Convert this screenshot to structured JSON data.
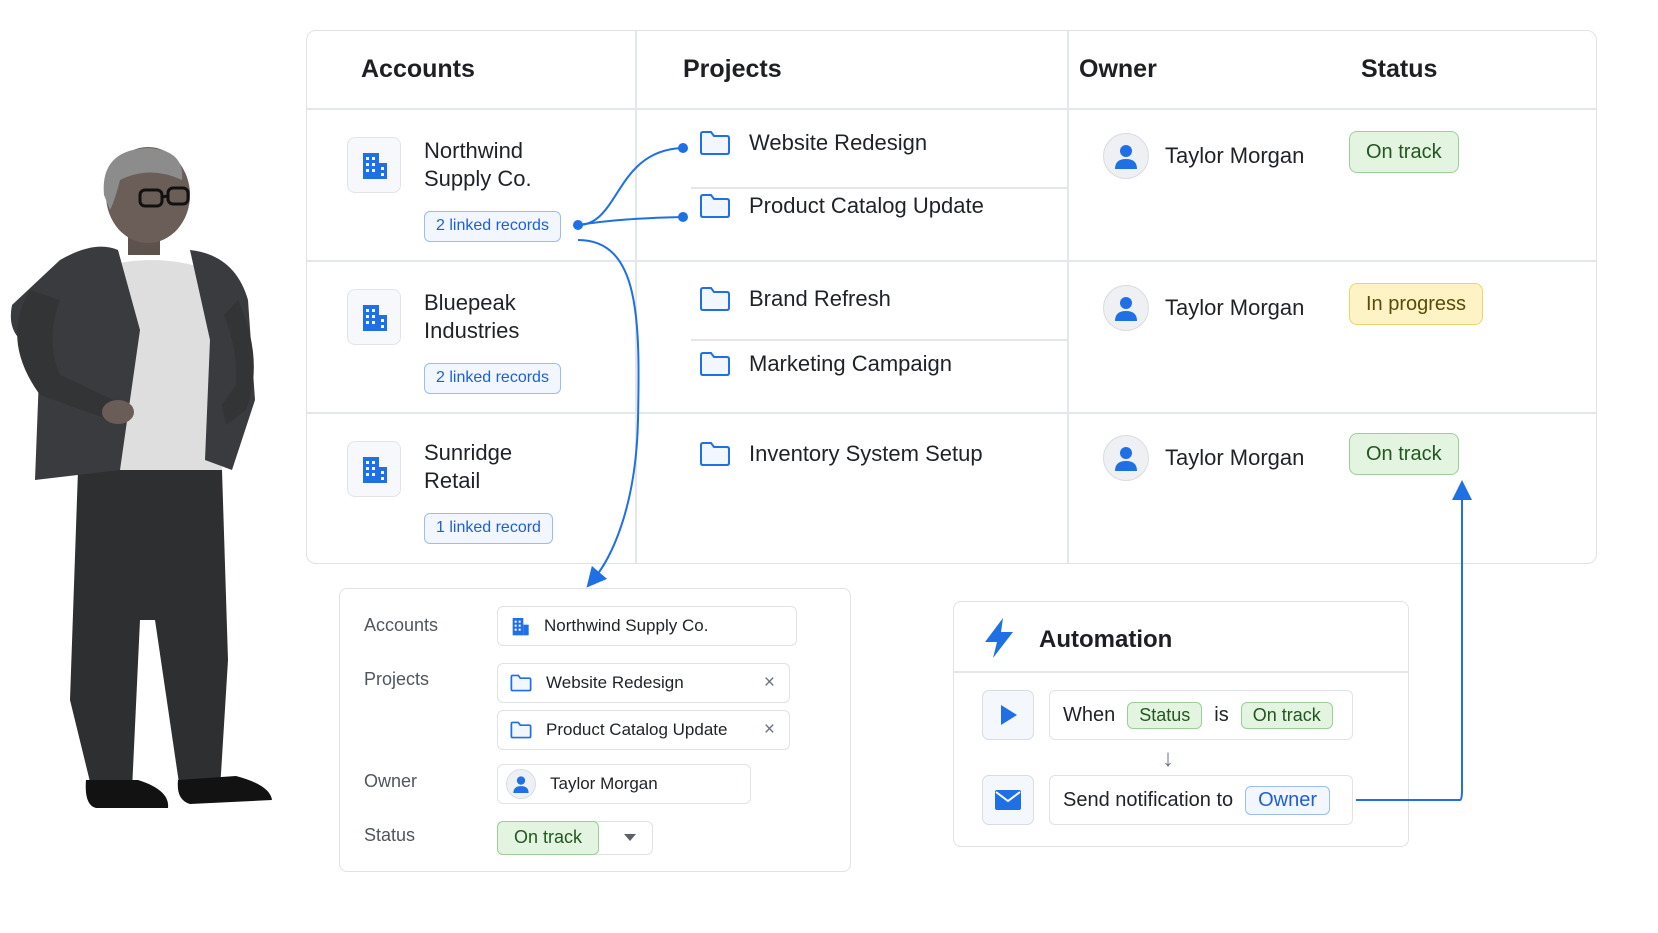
{
  "table": {
    "headers": {
      "accounts": "Accounts",
      "projects": "Projects",
      "owner": "Owner",
      "status": "Status"
    },
    "rows": [
      {
        "account_line1": "Northwind",
        "account_line2": "Supply Co.",
        "linked": "2 linked records",
        "projects": [
          "Website Redesign",
          "Product Catalog Update"
        ],
        "owner": "Taylor Morgan",
        "status": "On track",
        "status_color": "#e3f4e1"
      },
      {
        "account_line1": "Bluepeak",
        "account_line2": "Industries",
        "linked": "2 linked records",
        "projects": [
          "Brand Refresh",
          "Marketing Campaign"
        ],
        "owner": "Taylor Morgan",
        "status": "In progress",
        "status_color": "#fdf3c4"
      },
      {
        "account_line1": "Sunridge",
        "account_line2": "Retail",
        "linked": "1 linked record",
        "projects": [
          "Inventory System Setup"
        ],
        "owner": "Taylor Morgan",
        "status": "On track",
        "status_color": "#e3f4e1"
      }
    ]
  },
  "record_form": {
    "accounts_label": "Accounts",
    "account_value": "Northwind Supply Co.",
    "projects_label": "Projects",
    "projects": [
      "Website Redesign",
      "Product Catalog Update"
    ],
    "owner_label": "Owner",
    "owner_value": "Taylor Morgan",
    "status_label": "Status",
    "status_value": "On track",
    "remove_glyph": "×"
  },
  "automation": {
    "title": "Automation",
    "when_word": "When",
    "field": "Status",
    "is_word": "is",
    "value": "On track",
    "action_text": "Send notification to",
    "recipient": "Owner"
  },
  "icons": {
    "account": "building-icon",
    "project": "folder-icon",
    "owner": "person-icon",
    "trigger": "play-icon",
    "action": "mail-icon",
    "automation": "lightning-icon"
  },
  "colors": {
    "accent_blue": "#1f6fe5",
    "status_green": "#e3f4e1",
    "status_yellow": "#fdf3c4"
  }
}
